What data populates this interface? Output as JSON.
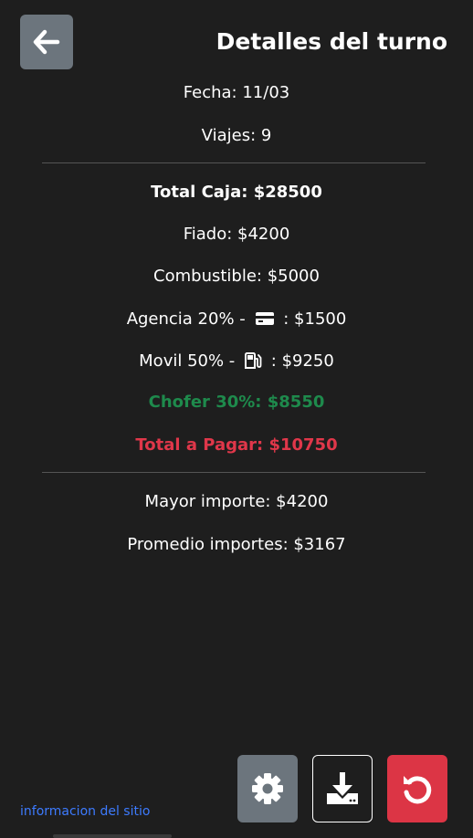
{
  "header": {
    "title": "Detalles del turno",
    "back_icon": "arrow-left-icon"
  },
  "summary": {
    "fecha": "Fecha: 11/03",
    "viajes": "Viajes: 9",
    "total_caja": "Total Caja: $28500",
    "fiado": "Fiado: $4200",
    "combustible": "Combustible: $5000",
    "agencia_label": "Agencia 20% -",
    "agencia_value": ": $1500",
    "agencia_icon": "credit-card-icon",
    "movil_label": "Movil 50% -",
    "movil_value": ": $9250",
    "movil_icon": "fuel-pump-icon",
    "chofer": "Chofer 30%: $8550",
    "total_pagar": "Total a Pagar: $10750",
    "mayor_importe": "Mayor importe: $4200",
    "promedio_importes": "Promedio importes: $3167"
  },
  "footer": {
    "info_link": "informacion del sitio",
    "settings_icon": "gear-icon",
    "download_icon": "download-icon",
    "reset_icon": "reset-icon"
  },
  "colors": {
    "background": "#1e1e1e",
    "secondary_button": "#6c757d",
    "success_text": "#1e8a4c",
    "danger_text": "#e0374a",
    "danger_button": "#dc3545",
    "link": "#3d7bff"
  }
}
